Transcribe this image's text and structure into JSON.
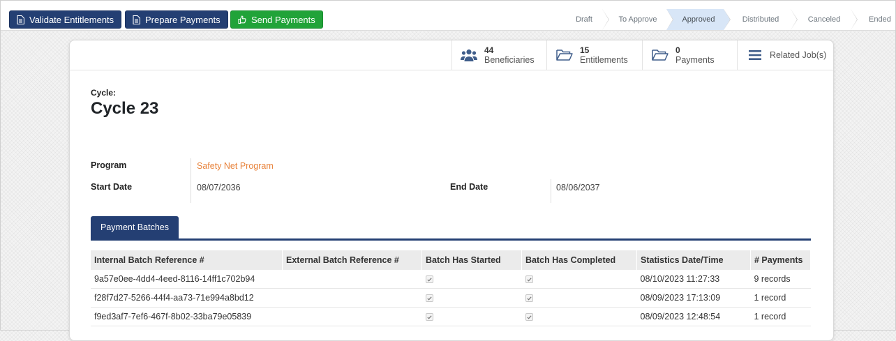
{
  "toolbar": {
    "validate_label": "Validate Entitlements",
    "prepare_label": "Prepare Payments",
    "send_label": "Send Payments"
  },
  "stages": [
    "Draft",
    "To Approve",
    "Approved",
    "Distributed",
    "Canceled",
    "Ended"
  ],
  "active_stage": "Approved",
  "stats": {
    "beneficiaries": {
      "count": "44",
      "label": "Beneficiaries"
    },
    "entitlements": {
      "count": "15",
      "label": "Entitlements"
    },
    "payments": {
      "count": "0",
      "label": "Payments"
    },
    "related_jobs": {
      "label": "Related Job(s)"
    }
  },
  "cycle": {
    "label": "Cycle:",
    "title": "Cycle 23"
  },
  "fields": {
    "program_label": "Program",
    "program_value": "Safety Net Program",
    "start_date_label": "Start Date",
    "start_date_value": "08/07/2036",
    "end_date_label": "End Date",
    "end_date_value": "08/06/2037"
  },
  "tabs": {
    "payment_batches": "Payment Batches"
  },
  "table": {
    "headers": [
      "Internal Batch Reference #",
      "External Batch Reference #",
      "Batch Has Started",
      "Batch Has Completed",
      "Statistics Date/Time",
      "# Payments"
    ],
    "rows": [
      {
        "internal": "9a57e0ee-4dd4-4eed-8116-14ff1c702b94",
        "external": "",
        "started": true,
        "completed": true,
        "datetime": "08/10/2023 11:27:33",
        "payments": "9 records"
      },
      {
        "internal": "f28f7d27-5266-44f4-aa73-71e994a8bd12",
        "external": "",
        "started": true,
        "completed": true,
        "datetime": "08/09/2023 17:13:09",
        "payments": "1 record"
      },
      {
        "internal": "f9ed3af7-7ef6-467f-8b02-33ba79e05839",
        "external": "",
        "started": true,
        "completed": true,
        "datetime": "08/09/2023 12:48:54",
        "payments": "1 record"
      }
    ]
  },
  "colors": {
    "primary": "#243f73",
    "success": "#21a339",
    "link": "#e8823a",
    "active_stage": "#d8e6f7"
  }
}
